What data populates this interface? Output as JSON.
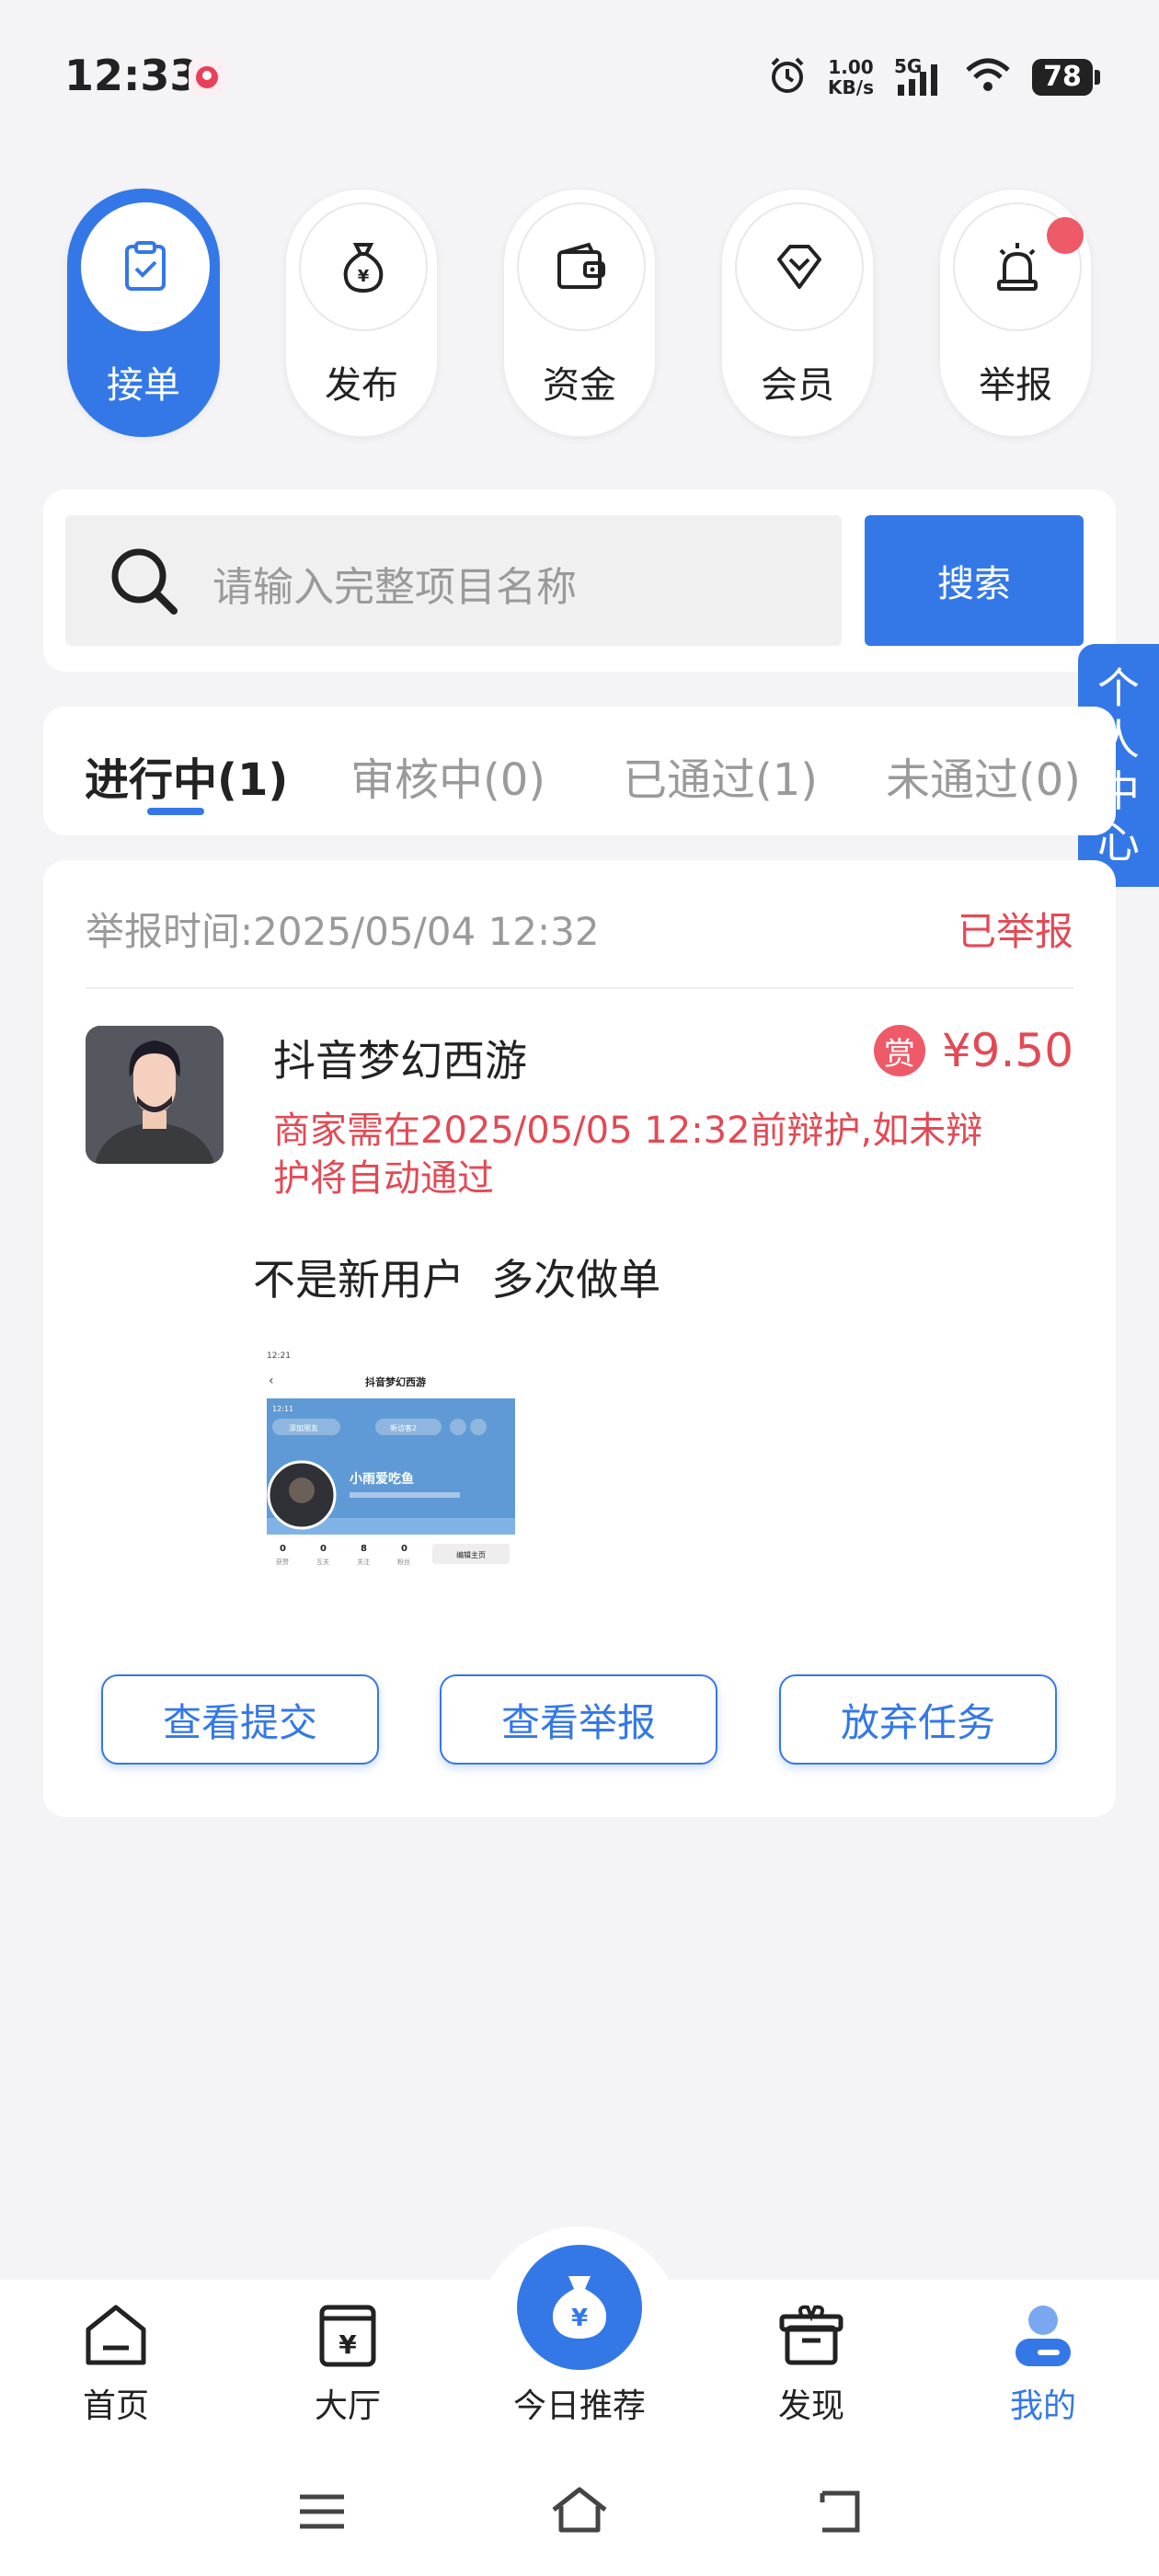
{
  "status_bar": {
    "time": "12:33",
    "net_speed_value": "1.00",
    "net_speed_unit": "KB/s",
    "network": "5G",
    "battery": "78"
  },
  "categories": [
    {
      "label": "接单",
      "icon": "clipboard-check-icon",
      "active": true
    },
    {
      "label": "发布",
      "icon": "money-bag-icon",
      "active": false
    },
    {
      "label": "资金",
      "icon": "wallet-icon",
      "active": false
    },
    {
      "label": "会员",
      "icon": "diamond-icon",
      "active": false
    },
    {
      "label": "举报",
      "icon": "alarm-light-icon",
      "active": false,
      "badge": true
    }
  ],
  "search": {
    "placeholder": "请输入完整项目名称",
    "button": "搜索"
  },
  "side_tab": {
    "label": [
      "个",
      "人",
      "中",
      "心"
    ]
  },
  "tabs": [
    {
      "label": "进行中(1)",
      "active": true
    },
    {
      "label": "审核中(0)",
      "active": false
    },
    {
      "label": "已通过(1)",
      "active": false
    },
    {
      "label": "未通过(0)",
      "active": false
    }
  ],
  "task": {
    "report_time": "举报时间:2025/05/04 12:32",
    "report_status": "已举报",
    "title": "抖音梦幻西游",
    "reward_badge": "赏",
    "reward_price": "¥9.50",
    "deadline_line1": "商家需在2025/05/05 12:32前辩护,如未辩",
    "deadline_line2": "护将自动通过",
    "note": "不是新用户  多次做单",
    "screenshot": {
      "time": "12:21",
      "title": "抖音梦幻西游",
      "inner_time": "12:11",
      "add_friend": "添加朋友",
      "new_visitors": "新访客2",
      "username": "小雨爱吃鱼",
      "stats": [
        {
          "value": "0",
          "label": "获赞"
        },
        {
          "value": "0",
          "label": "互关"
        },
        {
          "value": "8",
          "label": "关注"
        },
        {
          "value": "0",
          "label": "粉丝"
        }
      ],
      "edit_btn": "编辑主页"
    },
    "buttons": [
      "查看提交",
      "查看举报",
      "放弃任务"
    ]
  },
  "bottom_nav": [
    {
      "label": "首页",
      "icon": "home-icon",
      "active": false
    },
    {
      "label": "大厅",
      "icon": "hall-yen-icon",
      "active": false
    },
    {
      "label": "今日推荐",
      "icon": "money-bag-icon",
      "active": false,
      "center": true
    },
    {
      "label": "发现",
      "icon": "gift-box-icon",
      "active": false
    },
    {
      "label": "我的",
      "icon": "user-icon",
      "active": true
    }
  ],
  "colors": {
    "primary": "#3478e8",
    "danger": "#e24a55",
    "bg": "#f4f4f6"
  }
}
